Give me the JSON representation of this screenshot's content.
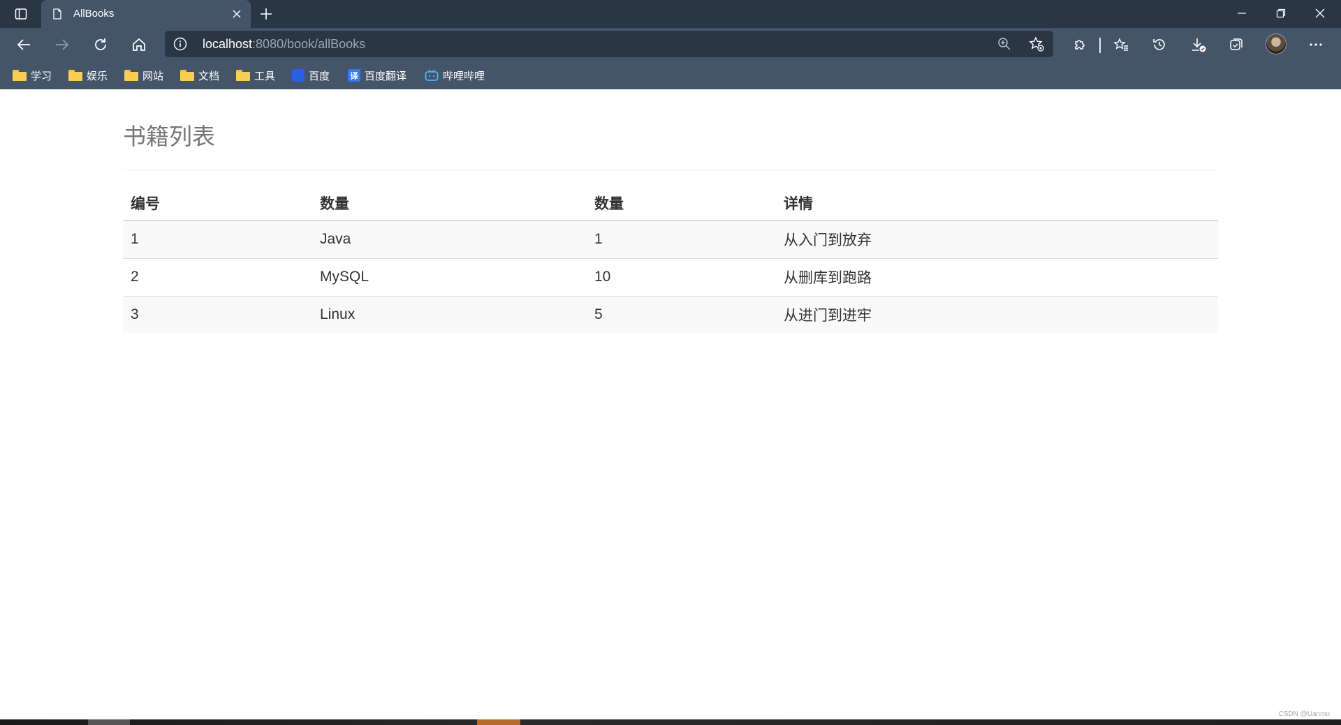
{
  "browser": {
    "tab_title": "AllBooks",
    "url_host": "localhost",
    "url_path": ":8080/book/allBooks"
  },
  "bookmarks": [
    {
      "label": "学习",
      "icon": "folder-icon"
    },
    {
      "label": "娱乐",
      "icon": "folder-icon"
    },
    {
      "label": "网站",
      "icon": "folder-icon"
    },
    {
      "label": "文档",
      "icon": "folder-icon"
    },
    {
      "label": "工具",
      "icon": "folder-icon"
    },
    {
      "label": "百度",
      "icon": "baidu-icon"
    },
    {
      "label": "百度翻译",
      "icon": "baidu-translate-icon"
    },
    {
      "label": "哔哩哔哩",
      "icon": "bilibili-icon"
    }
  ],
  "page": {
    "title": "书籍列表",
    "table": {
      "headers": [
        "编号",
        "数量",
        "数量",
        "详情"
      ],
      "rows": [
        [
          "1",
          "Java",
          "1",
          "从入门到放弃"
        ],
        [
          "2",
          "MySQL",
          "10",
          "从删库到跑路"
        ],
        [
          "3",
          "Linux",
          "5",
          "从进门到进牢"
        ]
      ]
    }
  },
  "watermark": "CSDN @Uanmo",
  "colors": {
    "titlebar": "#2b3645",
    "toolbar": "#455569",
    "heading": "#777777",
    "table_text": "#333333",
    "stripe": "#f9f9f9"
  }
}
